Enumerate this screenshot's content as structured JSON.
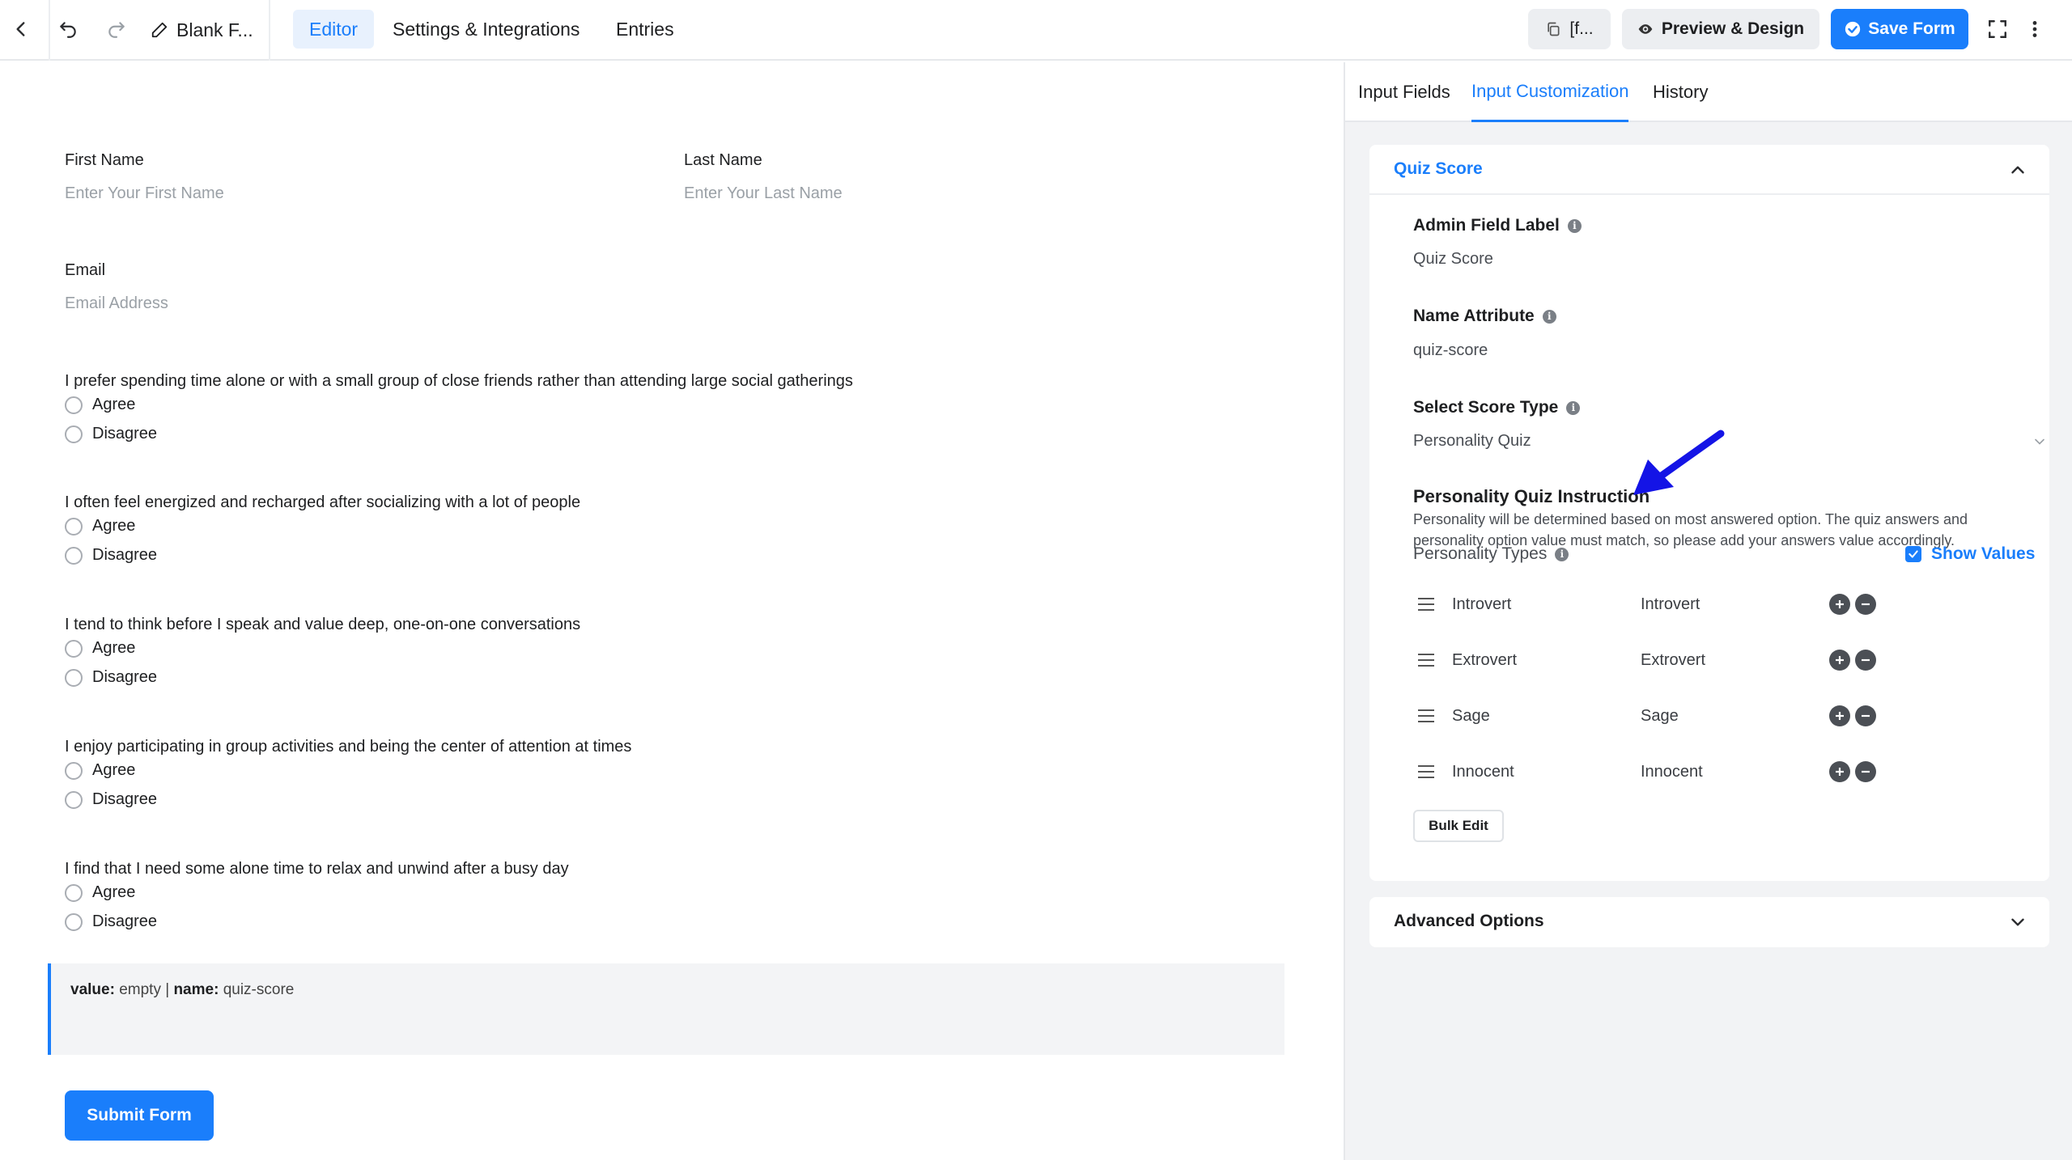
{
  "topbar": {
    "form_name": "Blank F...",
    "tabs": [
      {
        "label": "Editor",
        "active": true
      },
      {
        "label": "Settings & Integrations",
        "active": false
      },
      {
        "label": "Entries",
        "active": false
      }
    ],
    "shortcode_label": "[f...",
    "preview_label": "Preview & Design",
    "save_label": "Save Form"
  },
  "form": {
    "first_name": {
      "label": "First Name",
      "placeholder": "Enter Your First Name"
    },
    "last_name": {
      "label": "Last Name",
      "placeholder": "Enter Your Last Name"
    },
    "email": {
      "label": "Email",
      "placeholder": "Email Address"
    },
    "questions": [
      {
        "text": "I prefer spending time alone or with a small group of close friends rather than attending large social gatherings",
        "options": [
          "Agree",
          "Disagree"
        ]
      },
      {
        "text": "I often feel energized and recharged after socializing with a lot of people",
        "options": [
          "Agree",
          "Disagree"
        ]
      },
      {
        "text": "I tend to think before I speak and value deep, one-on-one conversations",
        "options": [
          "Agree",
          "Disagree"
        ]
      },
      {
        "text": "I enjoy participating in group activities and being the center of attention at times",
        "options": [
          "Agree",
          "Disagree"
        ]
      },
      {
        "text": "I find that I need some alone time to relax and unwind after a busy day",
        "options": [
          "Agree",
          "Disagree"
        ]
      }
    ],
    "score_box": {
      "value_key": "value:",
      "value": "empty",
      "sep": "|",
      "name_key": "name:",
      "name": "quiz-score"
    },
    "submit_label": "Submit Form"
  },
  "panel": {
    "tabs": [
      {
        "label": "Input Fields",
        "active": false
      },
      {
        "label": "Input Customization",
        "active": true
      },
      {
        "label": "History",
        "active": false
      }
    ],
    "quiz_card": {
      "title": "Quiz Score",
      "admin_label": {
        "label": "Admin Field Label",
        "value": "Quiz Score"
      },
      "name_attr": {
        "label": "Name Attribute",
        "value": "quiz-score"
      },
      "score_type": {
        "label": "Select Score Type",
        "value": "Personality Quiz"
      },
      "instruction_title": "Personality Quiz Instruction",
      "instruction_text": "Personality will be determined based on most answered option. The quiz answers and personality option value must match, so please add your answers value accordingly.",
      "personality_types_label": "Personality Types",
      "show_values_label": "Show Values",
      "types": [
        {
          "label": "Introvert",
          "value": "Introvert"
        },
        {
          "label": "Extrovert",
          "value": "Extrovert"
        },
        {
          "label": "Sage",
          "value": "Sage"
        },
        {
          "label": "Innocent",
          "value": "Innocent"
        }
      ],
      "bulk_edit_label": "Bulk Edit"
    },
    "advanced_title": "Advanced Options"
  },
  "colors": {
    "accent": "#1a7efb",
    "annotation_arrow": "#1414e6"
  }
}
